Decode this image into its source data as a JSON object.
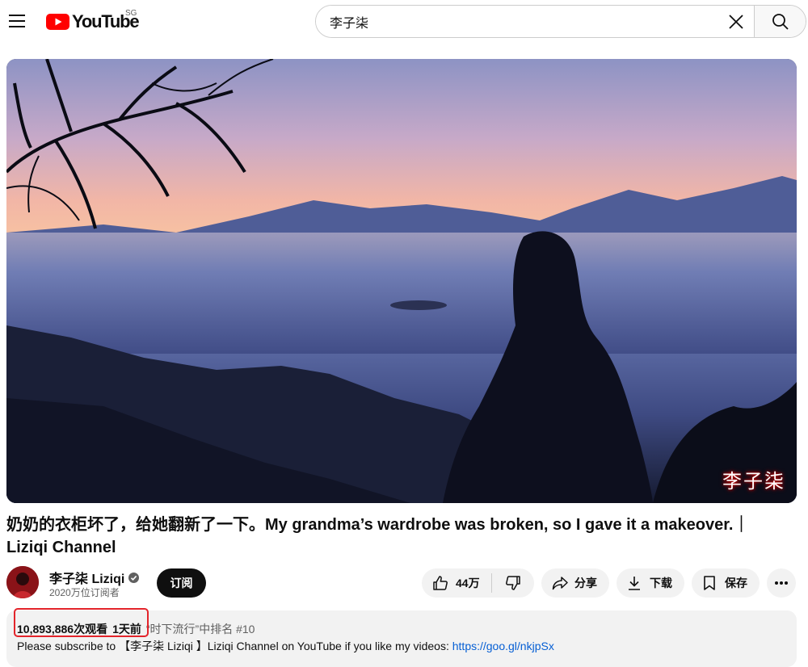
{
  "header": {
    "logo_text": "YouTube",
    "region": "SG",
    "search_value": "李子柒"
  },
  "video": {
    "watermark": "李子柒",
    "title": "奶奶的衣柜坏了，给她翻新了一下。My grandma’s wardrobe was broken, so I gave it a makeover.｜Liziqi Channel"
  },
  "channel": {
    "name": "李子柒 Liziqi",
    "subscribers": "2020万位订阅者",
    "subscribe_label": "订阅"
  },
  "actions": {
    "likes": "44万",
    "share": "分享",
    "download": "下载",
    "save": "保存"
  },
  "description": {
    "views": "10,893,886次观看",
    "age": "1天前",
    "trending": "“时下流行”中排名 #10",
    "text_prefix": "Please  subscribe to 【李子柒 Liziqi 】Liziqi Channel on YouTube if you like my videos: ",
    "link": "https://goo.gl/nkjpSx"
  },
  "colors": {
    "brand_red": "#ff0000",
    "link_blue": "#065fd4",
    "highlight_red": "#e3242b"
  }
}
